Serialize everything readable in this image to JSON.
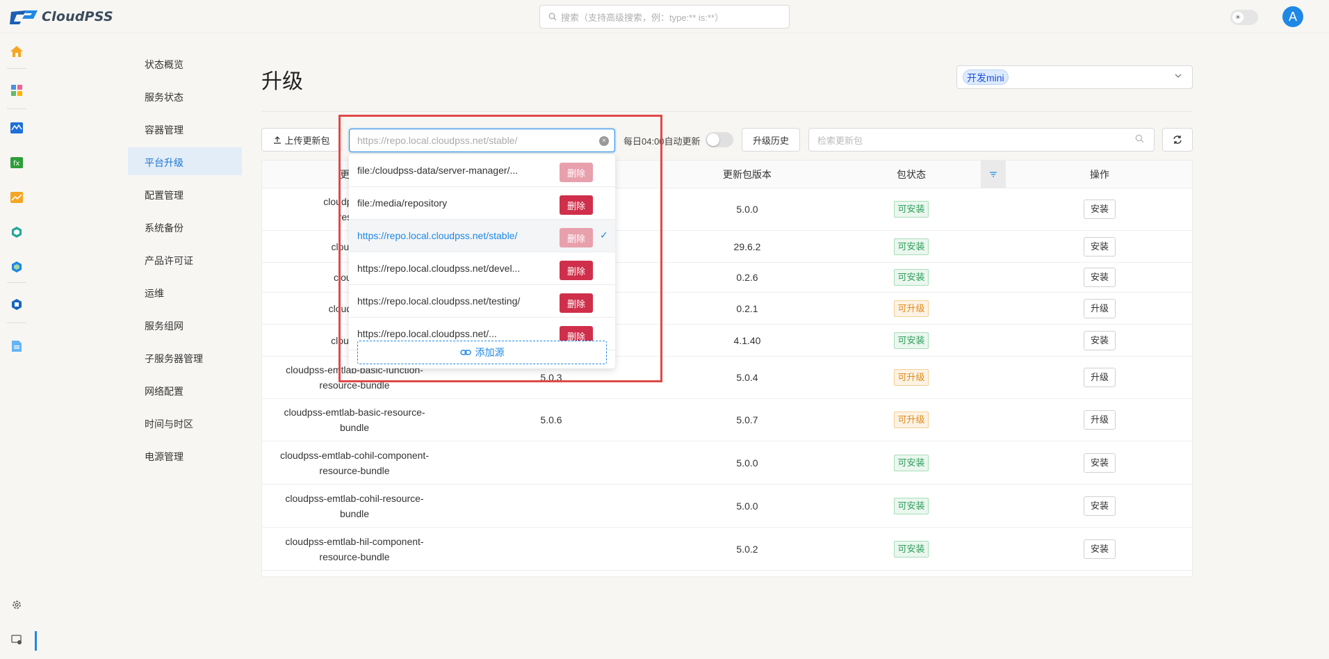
{
  "app": {
    "name": "CloudPSS"
  },
  "search": {
    "placeholder": "搜索（支持高级搜索，例：type:** is:**）"
  },
  "user": {
    "avatar_letter": "A"
  },
  "subnav": {
    "items": [
      {
        "label": "状态概览"
      },
      {
        "label": "服务状态"
      },
      {
        "label": "容器管理"
      },
      {
        "label": "平台升级"
      },
      {
        "label": "配置管理"
      },
      {
        "label": "系统备份"
      },
      {
        "label": "产品许可证"
      },
      {
        "label": "运维"
      },
      {
        "label": "服务组网"
      },
      {
        "label": "子服务器管理"
      },
      {
        "label": "网络配置"
      },
      {
        "label": "时间与时区"
      },
      {
        "label": "电源管理"
      }
    ],
    "active_index": 3
  },
  "page": {
    "title": "升级"
  },
  "env": {
    "selected": "开发mini"
  },
  "toolbar": {
    "upload_label": "上传更新包",
    "source_value": "https://repo.local.cloudpss.net/stable/",
    "auto_update_label": "每日04:00自动更新",
    "auto_update_on": false,
    "history_label": "升级历史",
    "search_placeholder": "检索更新包"
  },
  "table": {
    "headers": {
      "name": "更新包",
      "version": "更新包版本",
      "status": "包状态",
      "action": "操作"
    },
    "rows": [
      {
        "name_visible": "cloudpss-appli\nresourc",
        "installed": "",
        "version": "5.0.0",
        "status": "可安装",
        "action": "安装"
      },
      {
        "name_visible": "cloudpss-c",
        "installed": "",
        "version": "29.6.2",
        "status": "可安装",
        "action": "安装"
      },
      {
        "name_visible": "cloudpss-",
        "installed": "",
        "version": "0.2.6",
        "status": "可安装",
        "action": "安装"
      },
      {
        "name_visible": "cloudpss-dc",
        "installed": "",
        "version": "0.2.1",
        "status": "可升级",
        "action": "升级"
      },
      {
        "name_visible": "cloudpss-d",
        "installed": "",
        "version": "4.1.40",
        "status": "可安装",
        "action": "安装"
      },
      {
        "name_visible": "cloudpss-emtlab-basic-function-\nresource-bundle",
        "installed": "5.0.3",
        "version": "5.0.4",
        "status": "可升级",
        "action": "升级"
      },
      {
        "name_visible": "cloudpss-emtlab-basic-resource-\nbundle",
        "installed": "5.0.6",
        "version": "5.0.7",
        "status": "可升级",
        "action": "升级"
      },
      {
        "name_visible": "cloudpss-emtlab-cohil-component-\nresource-bundle",
        "installed": "",
        "version": "5.0.0",
        "status": "可安装",
        "action": "安装"
      },
      {
        "name_visible": "cloudpss-emtlab-cohil-resource-\nbundle",
        "installed": "",
        "version": "5.0.0",
        "status": "可安装",
        "action": "安装"
      },
      {
        "name_visible": "cloudpss-emtlab-hil-component-\nresource-bundle",
        "installed": "",
        "version": "5.0.2",
        "status": "可安装",
        "action": "安装"
      }
    ]
  },
  "sources": {
    "items": [
      {
        "url": "file:/cloudpss-data/server-manager/...",
        "delete": "删除",
        "delete_disabled": true,
        "selected": false
      },
      {
        "url": "file:/media/repository",
        "delete": "删除",
        "delete_disabled": false,
        "selected": false
      },
      {
        "url": "https://repo.local.cloudpss.net/stable/",
        "delete": "删除",
        "delete_disabled": true,
        "selected": true
      },
      {
        "url": "https://repo.local.cloudpss.net/devel...",
        "delete": "删除",
        "delete_disabled": false,
        "selected": false
      },
      {
        "url": "https://repo.local.cloudpss.net/testing/",
        "delete": "删除",
        "delete_disabled": false,
        "selected": false
      },
      {
        "url": "https://repo.local.cloudpss.net/...",
        "delete": "删除",
        "delete_disabled": false,
        "selected": false
      }
    ],
    "add_label": "添加源"
  },
  "colors": {
    "accent": "#1e88e5",
    "danger": "#cf2f4a",
    "success": "#2e9e5a",
    "warning": "#e08a1e",
    "highlight_box": "#e04848"
  }
}
